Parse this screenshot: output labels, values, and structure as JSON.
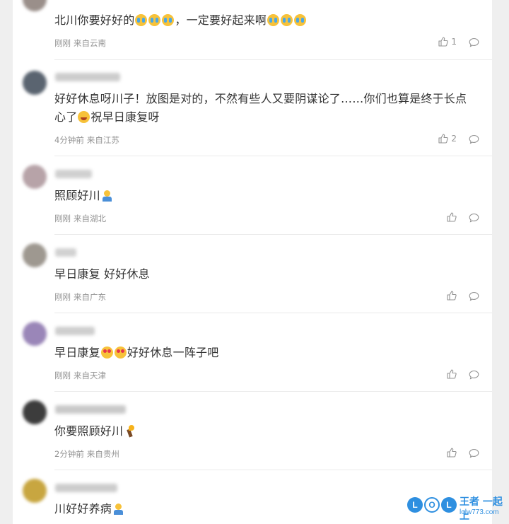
{
  "comments": [
    {
      "avatar_color": "#9a8f8a",
      "text_parts": [
        "北川你要好好的",
        "cry",
        "cry",
        "cry",
        "，一定要好起来啊",
        "cry",
        "cry",
        "cry"
      ],
      "time": "刚刚",
      "location": "来自云南",
      "likes": "1"
    },
    {
      "avatar_color": "#5a6470",
      "text": "好好休息呀川子！放图是对的，不然有些人又要阴谋论了……你们也算是终于长点心了",
      "text_suffix": "祝早日康复呀",
      "time": "4分钟前",
      "location": "来自江苏",
      "likes": "2"
    },
    {
      "avatar_color": "#b7a3a8",
      "text": "照顾好川",
      "time": "刚刚",
      "location": "来自湖北",
      "likes": ""
    },
    {
      "avatar_color": "#9e9890",
      "text": "早日康复 好好休息",
      "time": "刚刚",
      "location": "来自广东",
      "likes": ""
    },
    {
      "avatar_color": "#9a86b8",
      "text_a": "早日康复",
      "text_b": "好好休息一阵子吧",
      "time": "刚刚",
      "location": "来自天津",
      "likes": ""
    },
    {
      "avatar_color": "#3c3c3c",
      "text": "你要照顾好川",
      "time": "2分钟前",
      "location": "来自贵州",
      "likes": ""
    },
    {
      "avatar_color": "#c8a640",
      "text": "川好好养病",
      "time": "",
      "location": "",
      "likes": ""
    }
  ],
  "icons": {
    "like": "thumbs-up-icon",
    "reply": "comment-bubble-icon"
  },
  "colors": {
    "text": "#333333",
    "meta": "#939393",
    "watermark": "#2e8fe0"
  },
  "watermark": {
    "logo": "LOL",
    "title": "王者 一起上",
    "url": "lolw773.com"
  }
}
